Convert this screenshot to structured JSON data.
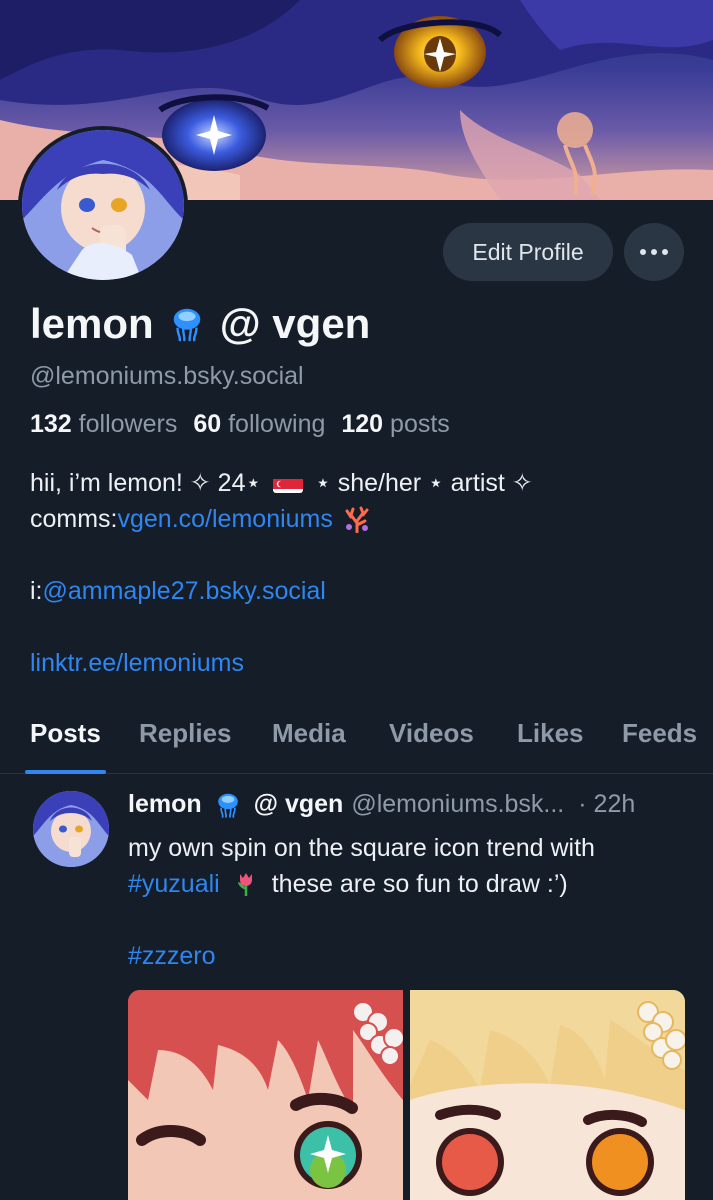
{
  "profile": {
    "display_name_part1": "lemon",
    "display_name_part2": "@ vgen",
    "handle": "@lemoniums.bsky.social",
    "edit_button": "Edit Profile",
    "stats": {
      "followers_count": "132",
      "followers_label": "followers",
      "following_count": "60",
      "following_label": "following",
      "posts_count": "120",
      "posts_label": "posts"
    },
    "bio": {
      "line1_a": "hii, i’m lemon! ✧ 24⋆",
      "line1_b": "⋆ she/her ⋆ artist ✧",
      "line2_prefix": "comms: ",
      "line2_link": "vgen.co/lemoniums",
      "line3_prefix": "i: ",
      "line3_link": "@ammaple27.bsky.social",
      "line4_link": "linktr.ee/lemoniums"
    }
  },
  "tabs": [
    {
      "label": "Posts"
    },
    {
      "label": "Replies"
    },
    {
      "label": "Media"
    },
    {
      "label": "Videos"
    },
    {
      "label": "Likes"
    },
    {
      "label": "Feeds"
    }
  ],
  "post": {
    "author_part1": "lemon",
    "author_part2": "@ vgen",
    "handle": "@lemoniums.bsk...",
    "time": "· 22h",
    "line1": "my own spin on the square icon trend with",
    "line2_tag": "#yuzuali",
    "line2_rest": "these are so fun to draw :’)",
    "line3_tag": "#zzzero"
  },
  "icons": {
    "jellyfish": "jellyfish-emoji",
    "flag": "singapore-flag-emoji",
    "coral": "coral-emoji",
    "tulip": "tulip-emoji",
    "more": "ellipsis-icon"
  },
  "colors": {
    "background": "#151d28",
    "accent": "#2f86f0",
    "muted": "#8e9aa8",
    "button": "#2b3644"
  }
}
